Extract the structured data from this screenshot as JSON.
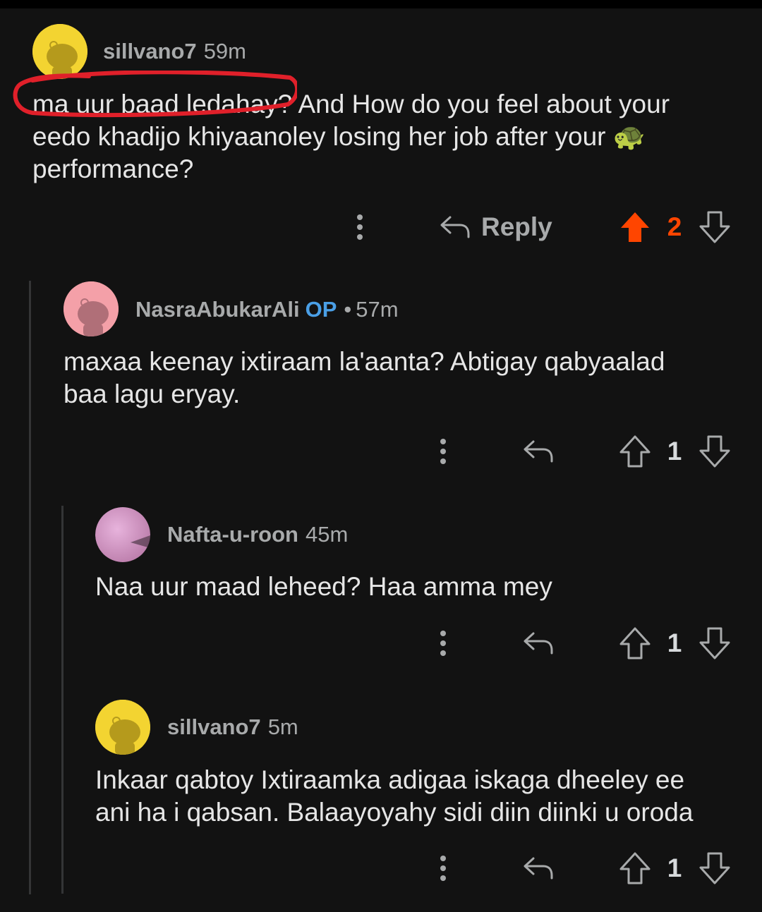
{
  "comments": [
    {
      "user": "sillvano7",
      "time": "59m",
      "body": "ma uur baad ledahay? And How do you feel about your eedo khadijo khiyaanoley losing her job after your 🐢 performance?",
      "body_lines": [
        "ma uur baad ledahay? And How do you feel about your",
        "eedo khadijo khiyaanoley losing her job after your 🐢",
        "performance?"
      ],
      "reply_label": "Reply",
      "score": "2",
      "upvoted": true,
      "avatar_color": "#f3d431"
    },
    {
      "user": "NasraAbukarAli",
      "op_badge": "OP",
      "separator": "•",
      "time": "57m",
      "body_lines": [
        "maxaa keenay ixtiraam la'aanta? Abtigay qabyaalad",
        "baa lagu eryay."
      ],
      "score": "1",
      "avatar_color": "#f4a0a8"
    },
    {
      "user": "Nafta-u-roon",
      "time": "45m",
      "body_lines": [
        "Naa uur maad leheed? Haa amma mey"
      ],
      "score": "1",
      "avatar_color": "#d28fc4"
    },
    {
      "user": "sillvano7",
      "time": "5m",
      "body_lines": [
        "Inkaar qabtoy Ixtiraamka adigaa iskaga dheeley ee",
        "ani ha i qabsan. Balaayoyahy sidi diin diinki u oroda"
      ],
      "score": "1",
      "avatar_color": "#f3d431"
    }
  ],
  "icons": {
    "more": "more-vertical-icon",
    "reply": "reply-arrow-icon",
    "upvote": "upvote-arrow-icon",
    "downvote": "downvote-arrow-icon",
    "emoji": "turtle-emoji"
  },
  "colors": {
    "background": "#121212",
    "upvote_active": "#ff4500",
    "op_badge": "#4a9fe6",
    "annotation": "#e0202a"
  }
}
